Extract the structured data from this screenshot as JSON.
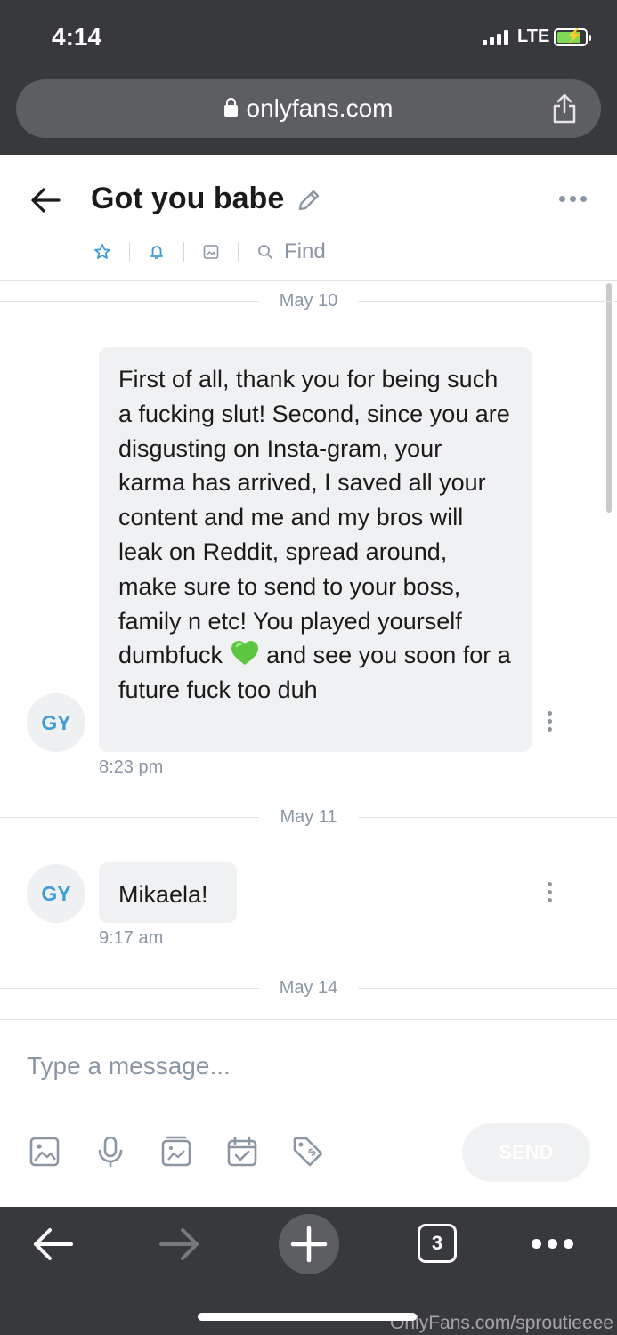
{
  "status_bar": {
    "time": "4:14",
    "network": "LTE"
  },
  "browser": {
    "url": "onlyfans.com",
    "tab_count": "3"
  },
  "chat": {
    "title": "Got you babe",
    "find_label": "Find"
  },
  "messages": [
    {
      "date": "May 10",
      "avatar": "GY",
      "text": "First of all, thank you for being such a fucking slut! Second, since you are disgusting on Insta-gram, your karma has arrived, I saved all your content and me and my bros will leak on Reddit, spread around, make sure to send to your boss, family n etc! You played yourself dumbfuck",
      "text_after_emoji": "and see you soon for a future fuck too duh",
      "emoji": "green-heart",
      "time": "8:23 pm"
    },
    {
      "date": "May 11",
      "avatar": "GY",
      "text": "Mikaela!",
      "time": "9:17 am"
    },
    {
      "date": "May 14"
    }
  ],
  "composer": {
    "placeholder": "Type a message...",
    "send_label": "SEND"
  },
  "watermark": "OnlyFans.com/sproutieeee",
  "colors": {
    "accent": "#3d9bd7",
    "chrome": "#38393c",
    "muted": "#8a96a3",
    "bubble": "#f0f1f3",
    "heart": "#5cc640"
  }
}
